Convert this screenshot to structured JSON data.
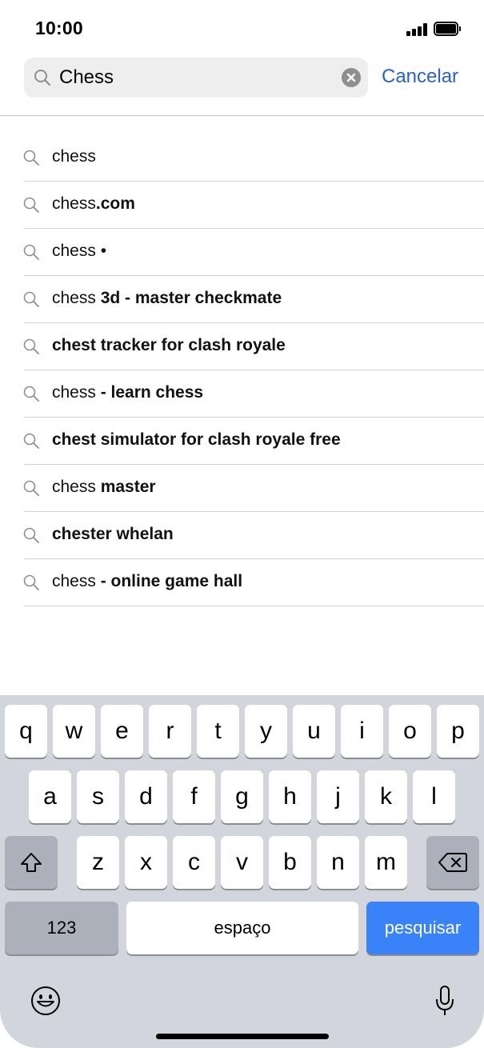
{
  "status_bar": {
    "time": "10:00"
  },
  "search": {
    "value": "Chess",
    "cancel_label": "Cancelar"
  },
  "suggestions": [
    {
      "normal": "chess",
      "bold": ""
    },
    {
      "normal": "chess",
      "bold": ".com"
    },
    {
      "normal": "chess •",
      "bold": ""
    },
    {
      "normal": "chess",
      "bold": " 3d - master checkmate"
    },
    {
      "normal": "",
      "bold": "chest tracker for clash royale"
    },
    {
      "normal": "chess",
      "bold": " - learn chess"
    },
    {
      "normal": "",
      "bold": "chest simulator for clash royale free"
    },
    {
      "normal": "chess",
      "bold": " master"
    },
    {
      "normal": "",
      "bold": "chester whelan"
    },
    {
      "normal": "chess",
      "bold": " - online game hall"
    }
  ],
  "keyboard": {
    "row1": [
      "q",
      "w",
      "e",
      "r",
      "t",
      "y",
      "u",
      "i",
      "o",
      "p"
    ],
    "row2": [
      "a",
      "s",
      "d",
      "f",
      "g",
      "h",
      "j",
      "k",
      "l"
    ],
    "row3": [
      "z",
      "x",
      "c",
      "v",
      "b",
      "n",
      "m"
    ],
    "numbers_label": "123",
    "space_label": "espaço",
    "search_label": "pesquisar",
    "shift_icon": "shift-icon",
    "delete_icon": "delete-icon",
    "emoji_icon": "emoji-icon",
    "mic_icon": "microphone-icon"
  },
  "colors": {
    "accent": "#2a62c9",
    "search_key": "#3a82f7"
  }
}
